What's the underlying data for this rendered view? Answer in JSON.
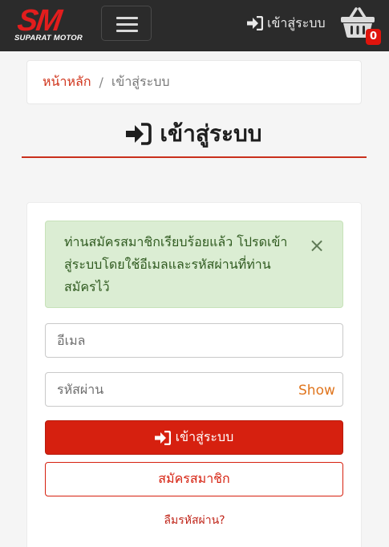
{
  "brand": {
    "logo_text": "SM",
    "logo_subtitle": "SUPARAT MOTOR"
  },
  "navbar": {
    "menu_icon": "hamburger-icon",
    "login_label": "เข้าสู่ระบบ",
    "login_icon": "sign-in-icon",
    "cart_icon": "basket-icon",
    "cart_count": "0"
  },
  "breadcrumb": {
    "home": "หน้าหลัก",
    "separator": "/",
    "current": "เข้าสู่ระบบ"
  },
  "page": {
    "title": "เข้าสู่ระบบ",
    "title_icon": "sign-in-icon"
  },
  "alert": {
    "message": "ท่านสมัครสมาชิกเรียบร้อยแล้ว โปรดเข้าสู่ระบบโดยใช้อีเมลและรหัสผ่านที่ท่านสมัครไว้",
    "close_symbol": "×"
  },
  "form": {
    "email_placeholder": "อีเมล",
    "email_value": "",
    "password_placeholder": "รหัสผ่าน",
    "password_value": "",
    "show_label": "Show",
    "login_button": "เข้าสู่ระบบ",
    "register_button": "สมัครสมาชิก",
    "forgot_link": "ลืมรหัสผ่าน?"
  },
  "colors": {
    "navbar_bg": "#2b2b2b",
    "brand_red": "#e21d1d",
    "primary_button": "#d6200f",
    "alert_bg": "#dbedd3",
    "accent_orange": "#e0761f"
  }
}
